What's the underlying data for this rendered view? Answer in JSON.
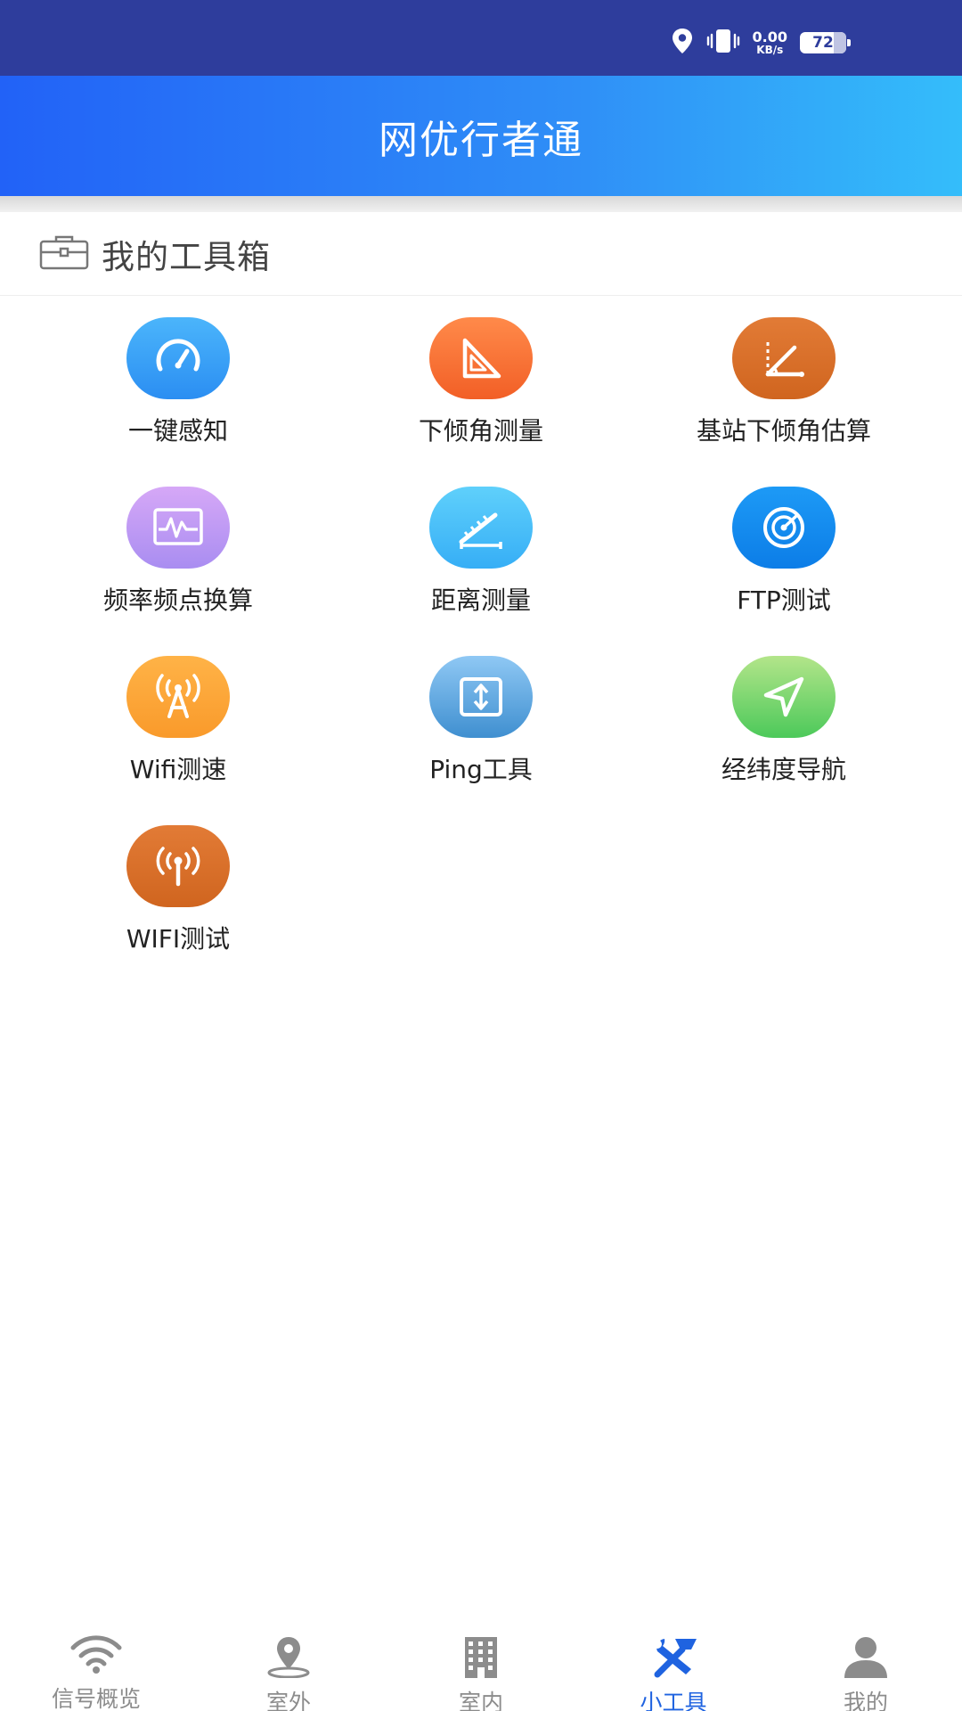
{
  "status_bar": {
    "net_speed_value": "0.00",
    "net_speed_unit": "KB/s",
    "battery": "72",
    "icons": [
      "location-icon",
      "vibrate-icon"
    ]
  },
  "header": {
    "title": "网优行者通"
  },
  "toolbox": {
    "title": "我的工具箱",
    "icon": "toolbox-icon",
    "tools": [
      {
        "label": "一键感知",
        "icon": "speedometer-icon",
        "color": "#2b8ef2"
      },
      {
        "label": "下倾角测量",
        "icon": "set-square-icon",
        "color": "#f25f26"
      },
      {
        "label": "基站下倾角估算",
        "icon": "angle-icon",
        "color": "#d0651f"
      },
      {
        "label": "频率频点换算",
        "icon": "waveform-icon",
        "color": "#a98df1"
      },
      {
        "label": "距离测量",
        "icon": "ruler-icon",
        "color": "#36aef6"
      },
      {
        "label": "FTP测试",
        "icon": "radar-icon",
        "color": "#0c7de7"
      },
      {
        "label": "Wifi测速",
        "icon": "signal-tower-icon",
        "color": "#f99a2b"
      },
      {
        "label": "Ping工具",
        "icon": "ping-arrows-icon",
        "color": "#3f8fd0"
      },
      {
        "label": "经纬度导航",
        "icon": "navigation-arrow-icon",
        "color": "#4cc95a"
      },
      {
        "label": "WIFI测试",
        "icon": "antenna-icon",
        "color": "#d0651f"
      }
    ]
  },
  "bottom_nav": {
    "active_color": "#1f63e0",
    "inactive_color": "#8c8c8c",
    "items": [
      {
        "label": "信号概览",
        "icon": "wifi-icon",
        "active": false
      },
      {
        "label": "室外",
        "icon": "map-pin-icon",
        "active": false
      },
      {
        "label": "室内",
        "icon": "building-icon",
        "active": false
      },
      {
        "label": "小工具",
        "icon": "tools-icon",
        "active": true
      },
      {
        "label": "我的",
        "icon": "user-icon",
        "active": false
      }
    ]
  }
}
